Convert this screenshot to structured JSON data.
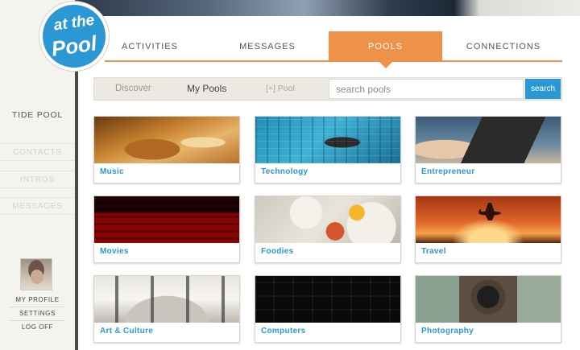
{
  "logo": {
    "line1": "at the",
    "line2": "Pool"
  },
  "tabs": [
    {
      "label": "ACTIVITIES",
      "active": false
    },
    {
      "label": "MESSAGES",
      "active": false
    },
    {
      "label": "POOLS",
      "active": true
    },
    {
      "label": "CONNECTIONS",
      "active": false
    }
  ],
  "subnav": {
    "discover": "Discover",
    "my_pools": "My Pools",
    "add_pool": "[+] Pool",
    "search_placeholder": "search pools",
    "search_button": "search"
  },
  "sidebar": {
    "active_label": "TIDE POOL",
    "items": [
      "CONTACTS",
      "INTROS",
      "MESSAGES"
    ],
    "profile": [
      "MY PROFILE",
      "SETTINGS",
      "LOG OFF"
    ]
  },
  "pools": [
    {
      "label": "Music"
    },
    {
      "label": "Technology"
    },
    {
      "label": "Entrepreneur"
    },
    {
      "label": "Movies"
    },
    {
      "label": "Foodies"
    },
    {
      "label": "Travel"
    },
    {
      "label": "Art & Culture"
    },
    {
      "label": "Computers"
    },
    {
      "label": "Photography"
    }
  ],
  "colors": {
    "accent": "#ee9149",
    "brand_blue": "#2b97d4",
    "sidebar_bg": "#f4f3ee"
  }
}
